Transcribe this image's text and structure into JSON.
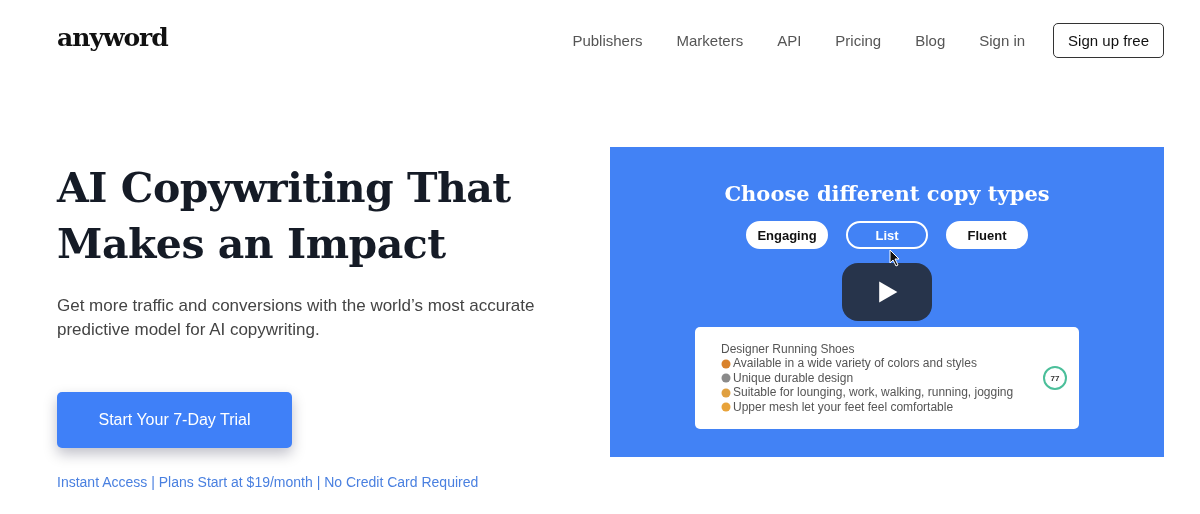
{
  "logo": "anyword",
  "nav": {
    "links": [
      "Publishers",
      "Marketers",
      "API",
      "Pricing",
      "Blog",
      "Sign in"
    ],
    "cta": "Sign up free"
  },
  "hero": {
    "title_lines": [
      "AI Copywriting That",
      "Makes an Impact"
    ],
    "subtitle": "Get more traffic and conversions with the world’s most accurate predictive model for AI copywriting.",
    "cta": "Start Your 7-Day Trial",
    "note": "Instant Access | Plans Start at $19/month | No Credit Card Required"
  },
  "video": {
    "heading": "Choose different copy types",
    "tabs": [
      {
        "label": "Engaging",
        "selected": false
      },
      {
        "label": "List",
        "selected": true
      },
      {
        "label": "Fluent",
        "selected": false
      }
    ],
    "card": {
      "title": "Designer Running Shoes",
      "items": [
        "Available in a wide variety of colors and styles",
        "Unique durable design",
        "Suitable for lounging, work, walking, running, jogging",
        "Upper mesh let your feet feel comfortable"
      ],
      "score": "77"
    }
  }
}
